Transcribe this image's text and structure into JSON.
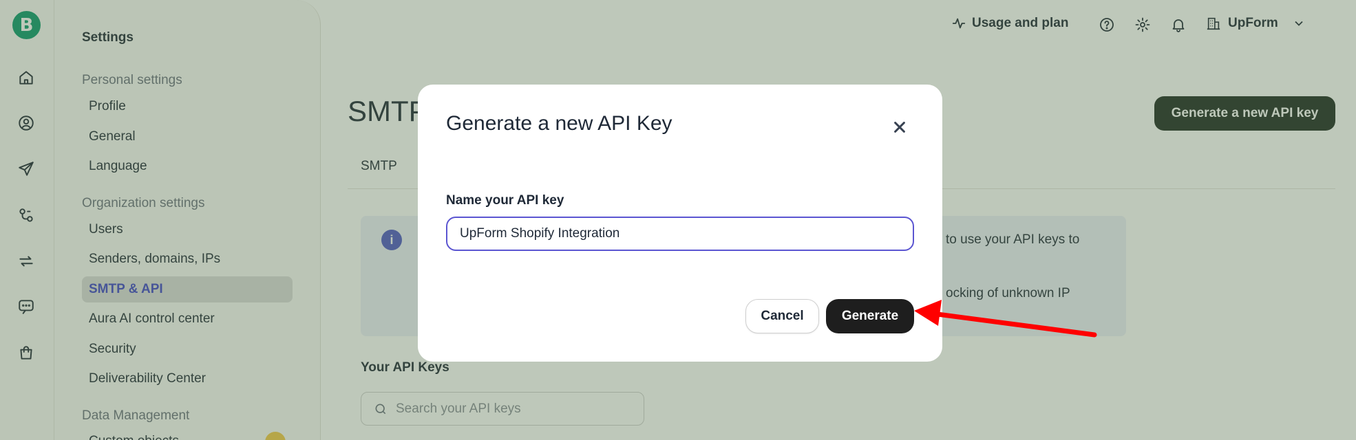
{
  "rail": {
    "logo_letter": "B",
    "icons": [
      "home-icon",
      "contacts-icon",
      "send-icon",
      "automation-icon",
      "transactional-icon",
      "conversations-icon",
      "shop-icon"
    ]
  },
  "settings": {
    "title": "Settings",
    "personal_heading": "Personal settings",
    "personal_items": [
      "Profile",
      "General",
      "Language"
    ],
    "org_heading": "Organization settings",
    "org_items": [
      "Users",
      "Senders, domains, IPs",
      "SMTP & API",
      "Aura AI control center",
      "Security",
      "Deliverability Center"
    ],
    "active_item": "SMTP & API",
    "data_heading": "Data Management",
    "data_items_partial": [
      "Custom objects"
    ]
  },
  "topbar": {
    "usage_label": "Usage and plan",
    "org_name": "UpForm"
  },
  "main": {
    "title": "SMTP & API",
    "generate_button": "Generate a new API key",
    "tab": "SMTP",
    "info_text_line1": "to use your API keys to",
    "info_text_line2": "ocking of unknown IP",
    "api_keys_title": "Your API Keys",
    "search_placeholder": "Search your API keys"
  },
  "modal": {
    "title": "Generate a new API Key",
    "field_label": "Name your API key",
    "field_value": "UpForm Shopify Integration",
    "cancel_label": "Cancel",
    "generate_label": "Generate"
  },
  "colors": {
    "brand": "#0b996e",
    "accent": "#5b55d1",
    "overlay": "#546e4a",
    "annotation": "#ff0000"
  }
}
